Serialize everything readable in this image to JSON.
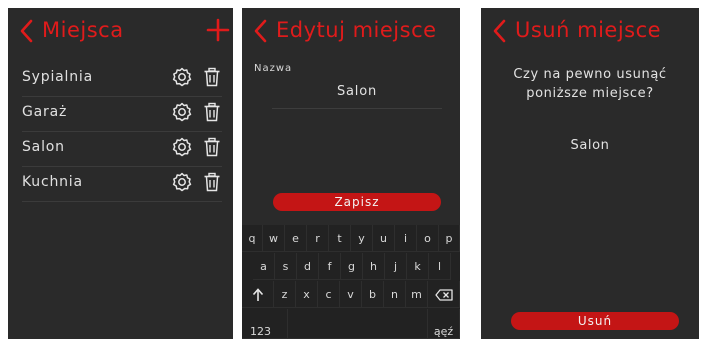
{
  "colors": {
    "accent": "#e01b1b",
    "panel_bg": "#2a2a2a",
    "button_red": "#c41515"
  },
  "places_screen": {
    "title": "Miejsca",
    "add_icon": "plus-icon",
    "back_icon": "chevron-left-icon",
    "items": [
      {
        "label": "Sypialnia",
        "settings_icon": "gear-icon",
        "delete_icon": "trash-icon"
      },
      {
        "label": "Garaż",
        "settings_icon": "gear-icon",
        "delete_icon": "trash-icon"
      },
      {
        "label": "Salon",
        "settings_icon": "gear-icon",
        "delete_icon": "trash-icon"
      },
      {
        "label": "Kuchnia",
        "settings_icon": "gear-icon",
        "delete_icon": "trash-icon"
      }
    ]
  },
  "edit_screen": {
    "title": "Edytuj miejsce",
    "back_icon": "chevron-left-icon",
    "name_label": "Nazwa",
    "name_value": "Salon",
    "save_label": "Zapisz",
    "keyboard": {
      "row1": [
        "q",
        "w",
        "e",
        "r",
        "t",
        "y",
        "u",
        "i",
        "o",
        "p"
      ],
      "row2": [
        "a",
        "s",
        "d",
        "f",
        "g",
        "h",
        "j",
        "k",
        "l"
      ],
      "row3": [
        "z",
        "x",
        "c",
        "v",
        "b",
        "n",
        "m"
      ],
      "shift_icon": "shift-arrow-icon",
      "backspace_icon": "backspace-icon",
      "numbers_label": "123",
      "special_label": "ąęź"
    }
  },
  "delete_screen": {
    "title": "Usuń miejsce",
    "back_icon": "chevron-left-icon",
    "question_line1": "Czy na pewno usunąć",
    "question_line2": "poniższe miejsce?",
    "place_name": "Salon",
    "delete_label": "Usuń"
  }
}
